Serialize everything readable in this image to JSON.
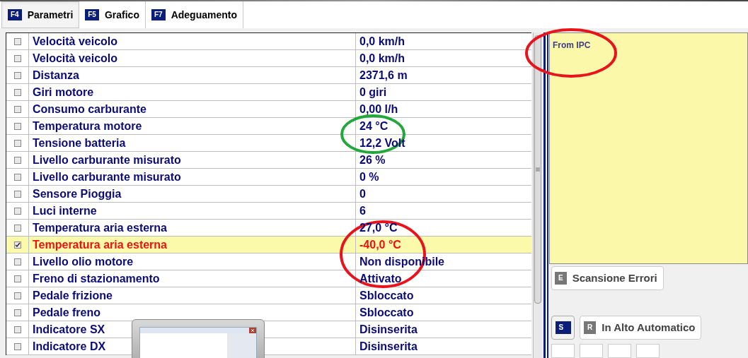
{
  "tabs": [
    {
      "key": "F4",
      "label": "Parametri",
      "selected": true
    },
    {
      "key": "F5",
      "label": "Grafico",
      "selected": false
    },
    {
      "key": "F7",
      "label": "Adeguamento",
      "selected": false
    }
  ],
  "rows": [
    {
      "name": "Velocità veicolo",
      "value": "0,0 km/h",
      "checked": false,
      "selected": false
    },
    {
      "name": "Velocità veicolo",
      "value": "0,0 km/h",
      "checked": false,
      "selected": false
    },
    {
      "name": "Distanza",
      "value": "2371,6 m",
      "checked": false,
      "selected": false
    },
    {
      "name": "Giri motore",
      "value": "0 giri",
      "checked": false,
      "selected": false
    },
    {
      "name": "Consumo carburante",
      "value": "0,00 l/h",
      "checked": false,
      "selected": false
    },
    {
      "name": "Temperatura motore",
      "value": "24 °C",
      "checked": false,
      "selected": false
    },
    {
      "name": "Tensione batteria",
      "value": "12,2 Volt",
      "checked": false,
      "selected": false
    },
    {
      "name": "Livello carburante misurato",
      "value": "26 %",
      "checked": false,
      "selected": false
    },
    {
      "name": "Livello carburante misurato",
      "value": "0 %",
      "checked": false,
      "selected": false
    },
    {
      "name": "Sensore Pioggia",
      "value": "0",
      "checked": false,
      "selected": false
    },
    {
      "name": "Luci interne",
      "value": "6",
      "checked": false,
      "selected": false
    },
    {
      "name": "Temperatura aria esterna",
      "value": "27,0 °C",
      "checked": false,
      "selected": false
    },
    {
      "name": "Temperatura aria esterna",
      "value": "-40,0 °C",
      "checked": true,
      "selected": true
    },
    {
      "name": "Livello olio motore",
      "value": "Non disponibile",
      "checked": false,
      "selected": false
    },
    {
      "name": "Freno di stazionamento",
      "value": "Attivato",
      "checked": false,
      "selected": false
    },
    {
      "name": "Pedale frizione",
      "value": "Sbloccato",
      "checked": false,
      "selected": false
    },
    {
      "name": "Pedale freno",
      "value": "Sbloccato",
      "checked": false,
      "selected": false
    },
    {
      "name": "Indicatore SX",
      "value": "Disinserita",
      "checked": false,
      "selected": false
    },
    {
      "name": "Indicatore DX",
      "value": "Disinserita",
      "checked": false,
      "selected": false
    }
  ],
  "info_panel": {
    "text": "From IPC"
  },
  "annotations": [
    {
      "color": "#22a83a"
    },
    {
      "color": "#e8141c"
    },
    {
      "color": "#e8141c"
    }
  ],
  "scan_button": {
    "key": "E",
    "label": "Scansione Errori"
  },
  "s_button": {
    "key": "S"
  },
  "auto_button": {
    "key": "R",
    "label": "In Alto Automatico"
  }
}
